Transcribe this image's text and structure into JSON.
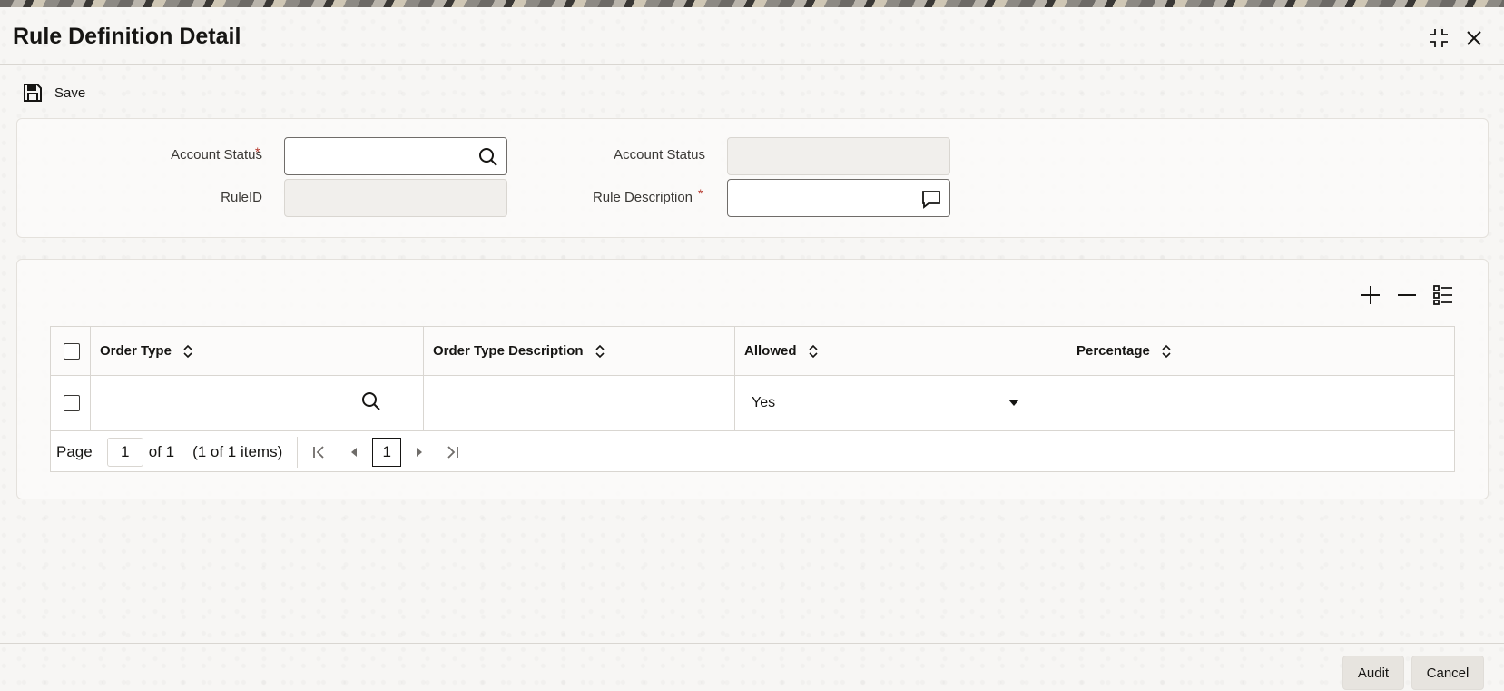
{
  "window": {
    "title": "Rule Definition Detail"
  },
  "toolbar": {
    "save_label": "Save"
  },
  "header_form": {
    "account_status_label": "Account Status",
    "account_status_value": "",
    "account_status_required": "*",
    "account_status_desc_label": "Account Status",
    "account_status_desc_value": "",
    "rule_id_label": "RuleID",
    "rule_id_value": "",
    "rule_description_label": "Rule Description",
    "rule_description_value": "",
    "rule_description_required": "*"
  },
  "grid": {
    "columns": [
      "Order Type",
      "Order Type Description",
      "Allowed",
      "Percentage"
    ],
    "rows": [
      {
        "order_type": "",
        "order_type_description": "",
        "allowed": "Yes",
        "percentage": ""
      }
    ],
    "pager": {
      "page_label": "Page",
      "page_value": "1",
      "of_label": "of 1",
      "items_label": "(1 of 1 items)",
      "current_page": "1"
    }
  },
  "footer": {
    "audit_label": "Audit",
    "cancel_label": "Cancel"
  },
  "icons": {
    "minimize": "compress-icon",
    "close": "close-icon",
    "save": "floppy-disk-icon",
    "search": "search-icon",
    "comment": "comment-icon",
    "add_row": "plus-icon",
    "delete_row": "minus-icon",
    "single_view": "list-detail-icon",
    "sort": "sort-icon"
  },
  "colors": {
    "required": "#b5352a",
    "text": "#161513",
    "border": "#d9d6d1"
  }
}
